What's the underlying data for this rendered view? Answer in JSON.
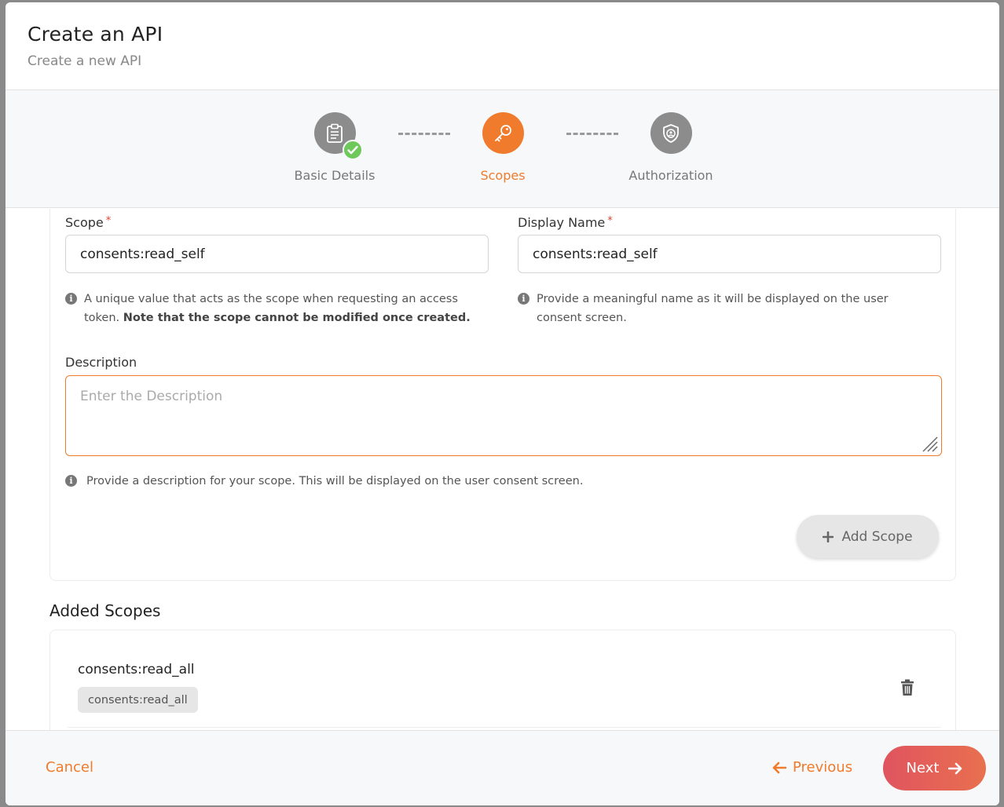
{
  "header": {
    "title": "Create an API",
    "subtitle": "Create a new API"
  },
  "stepper": {
    "steps": [
      {
        "label": "Basic Details",
        "state": "completed",
        "icon": "clipboard-icon"
      },
      {
        "label": "Scopes",
        "state": "active",
        "icon": "key-icon"
      },
      {
        "label": "Authorization",
        "state": "pending",
        "icon": "shield-user-icon"
      }
    ]
  },
  "form": {
    "scope": {
      "label": "Scope",
      "required_mark": "*",
      "value": "consents:read_self",
      "hint_text": "A unique value that acts as the scope when requesting an access token.",
      "hint_bold": "Note that the scope cannot be modified once created."
    },
    "display_name": {
      "label": "Display Name",
      "required_mark": "*",
      "value": "consents:read_self",
      "hint_text": "Provide a meaningful name as it will be displayed on the user consent screen."
    },
    "description": {
      "label": "Description",
      "placeholder": "Enter the Description",
      "value": "",
      "hint_text": "Provide a description for your scope. This will be displayed on the user consent screen."
    },
    "add_button_label": "Add Scope"
  },
  "added_scopes": {
    "title": "Added Scopes",
    "items": [
      {
        "name": "consents:read_all",
        "display_name": "consents:read_all"
      }
    ]
  },
  "footer": {
    "cancel_label": "Cancel",
    "previous_label": "Previous",
    "next_label": "Next"
  },
  "colors": {
    "accent": "#f07b2c",
    "completed": "#6fc85b",
    "inactive_step": "#8c8c8c",
    "next_gradient_start": "#e0545f",
    "next_gradient_end": "#e8704f"
  }
}
